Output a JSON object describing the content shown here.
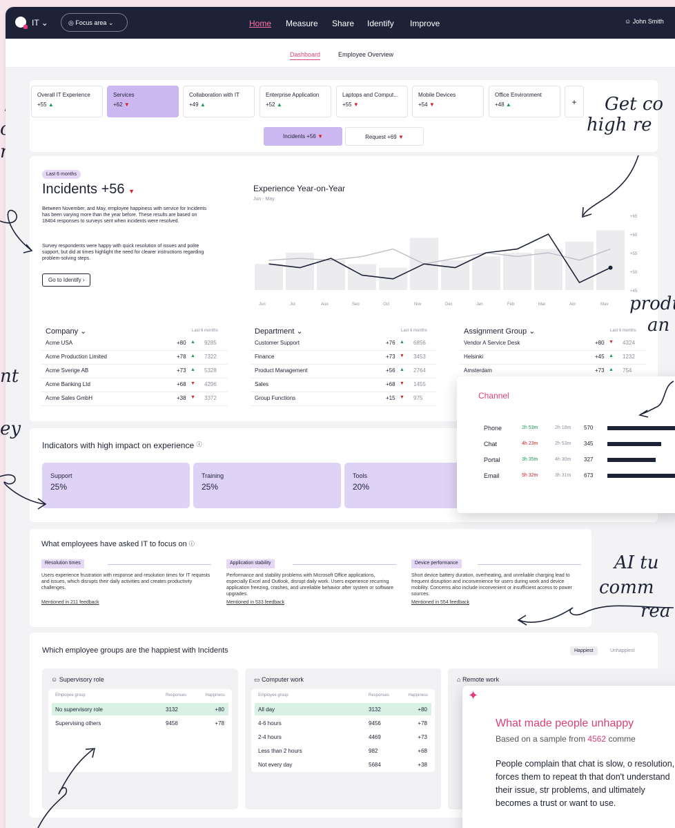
{
  "app": {
    "org": "IT",
    "focus_area": "Focus area",
    "user": "John Smith",
    "nav": [
      "Home",
      "Measure",
      "Share",
      "Identify",
      "Improve"
    ],
    "subnav": [
      "Dashboard",
      "Employee Overview"
    ]
  },
  "tabs": [
    {
      "label": "Overall IT Experience",
      "value": "+55",
      "trend": "▲"
    },
    {
      "label": "Services",
      "value": "+62",
      "trend": "▼"
    },
    {
      "label": "Collaboration with IT",
      "value": "+49",
      "trend": "▲"
    },
    {
      "label": "Enterprise Application",
      "value": "+52",
      "trend": "▲"
    },
    {
      "label": "Laptops and Comput...",
      "value": "+55",
      "trend": "▼"
    },
    {
      "label": "Mobile Devices",
      "value": "+54",
      "trend": "▼"
    },
    {
      "label": "Office Environment",
      "value": "+48",
      "trend": "▲"
    }
  ],
  "add_tab": "+",
  "segments": {
    "incidents": "Incidents +56",
    "request": "Request +69"
  },
  "summary": {
    "badge": "Last 6 months",
    "title": "Incidents +56",
    "p1": "Between November, and May, employee happiness with service for Incidents has been varying more than the year before. These results are based on 18404 responses to surveys sent when incidents were resolved.",
    "p2": "Survey respondents were happy with quick resolution of issues and polite support, but did at times highlight the need for clearer instructions regarding problem-solving steps.",
    "button": "Go to Identify"
  },
  "chart_data": {
    "type": "line",
    "title": "Experience Year-on-Year",
    "subtitle": "Jun - May",
    "x": [
      "Jun",
      "Jul",
      "Aug",
      "Sep",
      "Oct",
      "Nov",
      "Dec",
      "Jan",
      "Feb",
      "Mar",
      "Apr",
      "May"
    ],
    "y_ticks": [
      "+65",
      "+60",
      "+55",
      "+50",
      "+45"
    ],
    "ylim": [
      45,
      65
    ],
    "bars": [
      52,
      55,
      53,
      52,
      51,
      59,
      53,
      54,
      55,
      56,
      58,
      61
    ],
    "series": [
      {
        "values": [
          53,
          53.5,
          53,
          54,
          56,
          52,
          53.5,
          55,
          54,
          55,
          53,
          56
        ]
      },
      {
        "values": [
          52,
          51,
          53.5,
          49,
          48,
          52,
          51,
          55,
          56,
          60,
          47,
          51
        ]
      }
    ]
  },
  "company": {
    "title": "Company",
    "range": "Last 6 months",
    "rows": [
      {
        "name": "Acme USA",
        "score": "+80",
        "trend": "▲",
        "n": "9285"
      },
      {
        "name": "Acme Production Limited",
        "score": "+78",
        "trend": "▲",
        "n": "7322"
      },
      {
        "name": "Acme Sverige AB",
        "score": "+73",
        "trend": "▲",
        "n": "5328"
      },
      {
        "name": "Acme Banking Ltd",
        "score": "+68",
        "trend": "▼",
        "n": "4296"
      },
      {
        "name": "Acme Sales GmbH",
        "score": "+38",
        "trend": "▼",
        "n": "3372"
      }
    ]
  },
  "department": {
    "title": "Department",
    "range": "Last 6 months",
    "rows": [
      {
        "name": "Customer Support",
        "score": "+76",
        "trend": "▲",
        "n": "6856"
      },
      {
        "name": "Finance",
        "score": "+73",
        "trend": "▼",
        "n": "3453"
      },
      {
        "name": "Product Management",
        "score": "+56",
        "trend": "▲",
        "n": "2764"
      },
      {
        "name": "Sales",
        "score": "+68",
        "trend": "▼",
        "n": "1455"
      },
      {
        "name": "Group Functions",
        "score": "+15",
        "trend": "▼",
        "n": "975"
      }
    ]
  },
  "assignment": {
    "title": "Assignment Group",
    "range": "Last 6 months",
    "rows": [
      {
        "name": "Vendor A Service Desk",
        "score": "+80",
        "trend": "▼",
        "n": "4324"
      },
      {
        "name": "Helsinki",
        "score": "+45",
        "trend": "▲",
        "n": "1232"
      },
      {
        "name": "Amsterdam",
        "score": "+73",
        "trend": "▲",
        "n": "754"
      }
    ]
  },
  "channel": {
    "title": "Channel",
    "rows": [
      {
        "name": "Phone",
        "t1": "2h 53m",
        "t2": "2h 18m",
        "n": "570",
        "share": 1.0
      },
      {
        "name": "Chat",
        "t1": "4h 23m",
        "t2": "2h 53m",
        "n": "345",
        "share": 0.78
      },
      {
        "name": "Portal",
        "t1": "3h 35m",
        "t2": "4h 30m",
        "n": "327",
        "share": 0.7
      },
      {
        "name": "Email",
        "t1": "5h 32m",
        "t2": "3h 31m",
        "n": "673",
        "share": 1.0
      }
    ]
  },
  "indicators": {
    "title": "Indicators with high impact on experience",
    "info": "ⓘ",
    "items": [
      {
        "label": "Support",
        "value": "25%"
      },
      {
        "label": "Training",
        "value": "25%"
      },
      {
        "label": "Tools",
        "value": "20%"
      }
    ]
  },
  "focus": {
    "title": "What employees have asked IT to focus on",
    "info": "ⓘ",
    "items": [
      {
        "tag": "Resolution times",
        "text": "Users experience frustration with response and resolution times for IT requests and issues, which disrupts their daily activities and creates productivity challenges.",
        "link": "Mentioned in 211 feedback"
      },
      {
        "tag": "Application stability",
        "text": "Performance and stability problems with Microsoft Office applications, especially Excel and Outlook, disrupt daily work. Users experience recurring application freezing, crashes, and unreliable behavior after system or software upgrades.",
        "link": "Mentioned in 533 feedback"
      },
      {
        "tag": "Device performance",
        "text": "Short device battery duration, overheating, and unreliable charging lead to frequent disruption and inconvenience for users during work and device mobility. Concerns also include inconvenient or insufficient access to power sources.",
        "link": "Mentioned in 554 feedback"
      }
    ]
  },
  "groups": {
    "title": "Which employee groups are the happiest with Incidents",
    "toggle": [
      "Happiest",
      "Unhappiest"
    ],
    "headers": [
      "Employee group",
      "Responses",
      "Happiness"
    ],
    "cards": [
      {
        "title": "Supervisory role",
        "rows": [
          {
            "g": "No supervisory role",
            "r": "3132",
            "h": "+80"
          },
          {
            "g": "Supervising others",
            "r": "9456",
            "h": "+78"
          }
        ]
      },
      {
        "title": "Computer work",
        "rows": [
          {
            "g": "All day",
            "r": "3132",
            "h": "+80"
          },
          {
            "g": "4-6 hours",
            "r": "9456",
            "h": "+78"
          },
          {
            "g": "2-4 hours",
            "r": "4469",
            "h": "+73"
          },
          {
            "g": "Less than 2 hours",
            "r": "982",
            "h": "+68"
          },
          {
            "g": "Not every day",
            "r": "5684",
            "h": "+38"
          }
        ]
      },
      {
        "title": "Remote work",
        "rows": []
      }
    ]
  },
  "ai": {
    "title": "What made people unhappy",
    "sub_pre": "Based on a sample from ",
    "sub_num": "4562",
    "sub_post": " comme",
    "text": "People complain that chat is slow, o resolution, forces them to repeat th that don't understand their issue, str problems, and ultimately becomes a trust or want to use."
  },
  "annotations": [
    "ll",
    "our",
    "nce",
    "Get co",
    "high re",
    "produ",
    "an",
    "nt",
    "ey",
    "AI tu",
    "comm",
    "rea"
  ]
}
